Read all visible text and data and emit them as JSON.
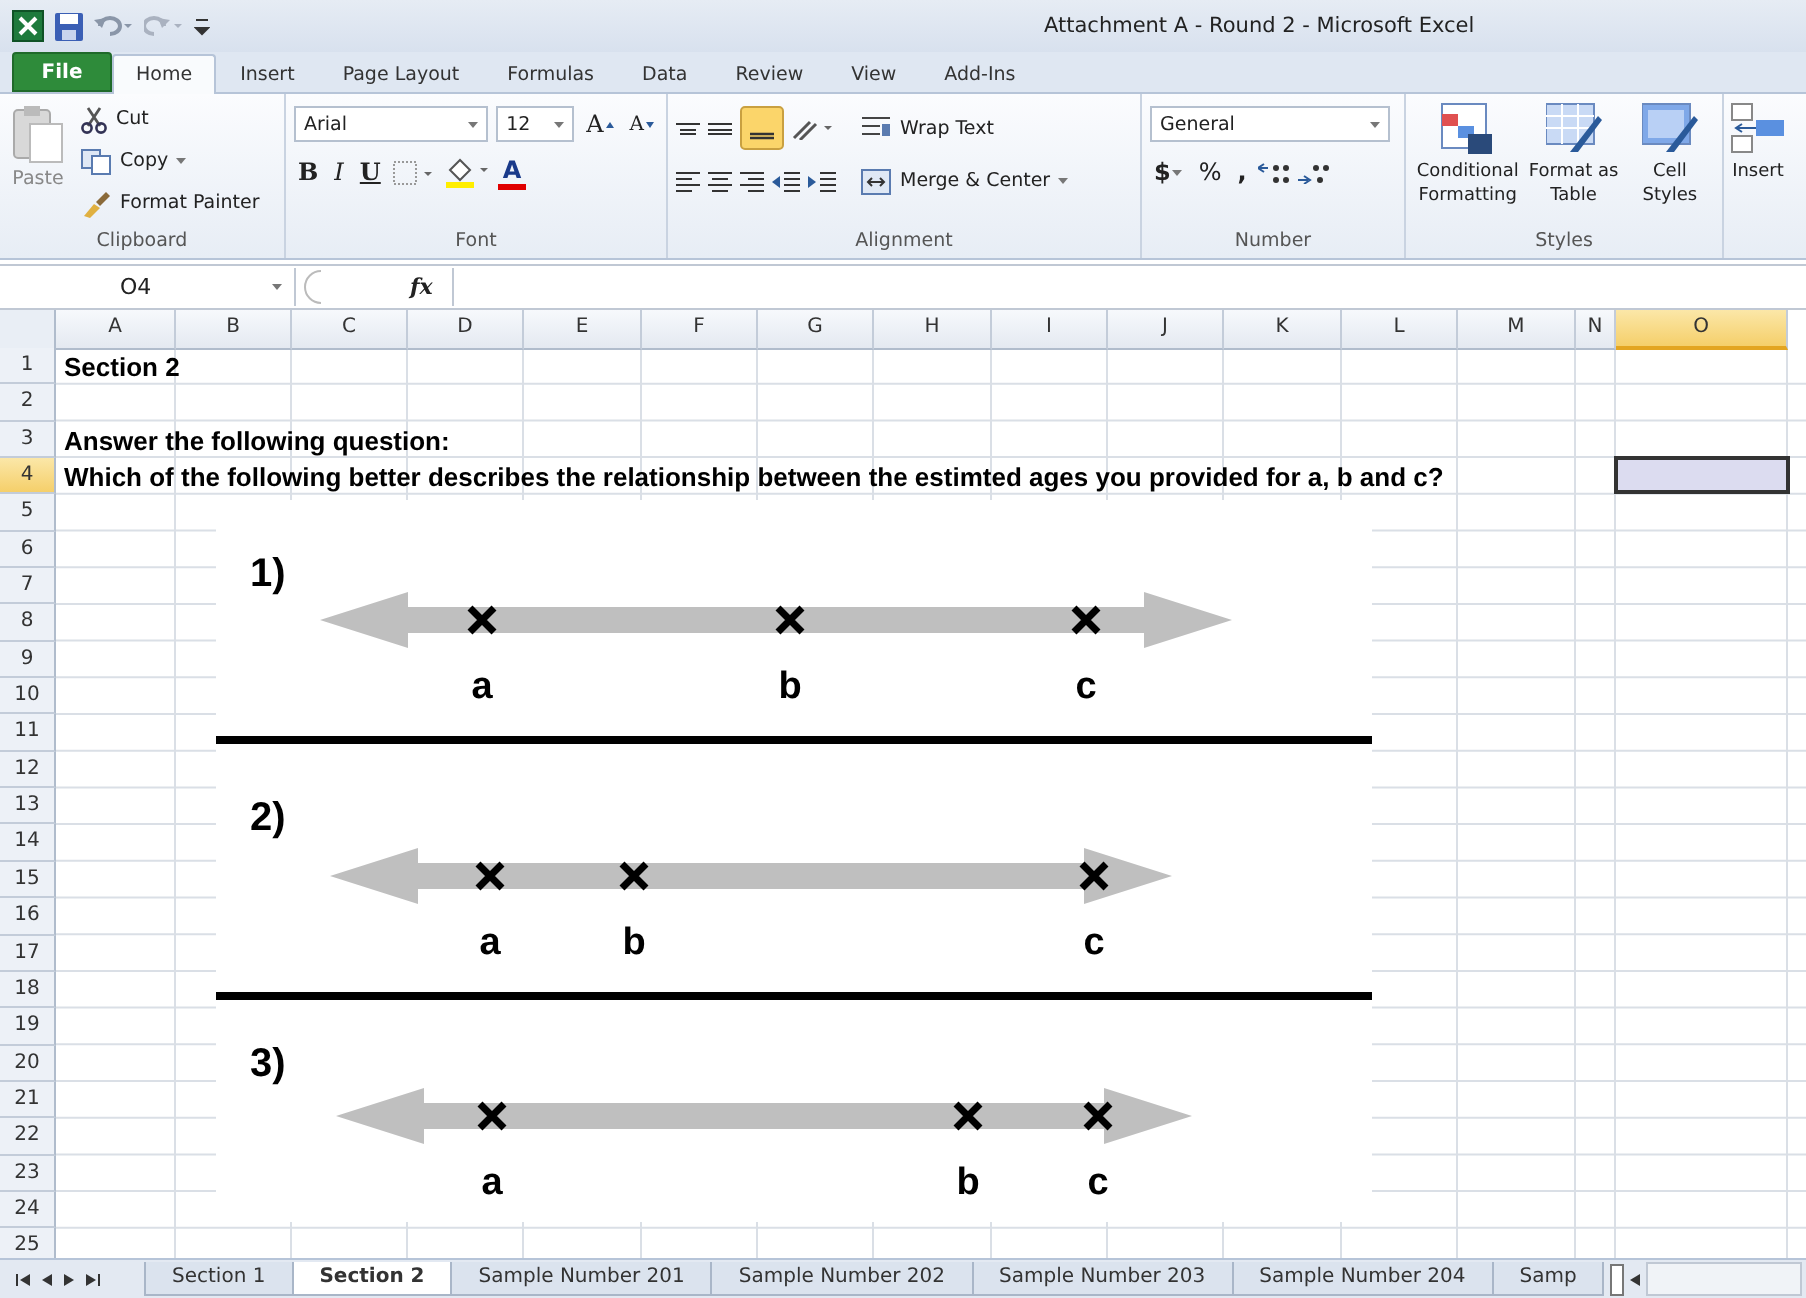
{
  "window": {
    "title": "Attachment A - Round 2 - Microsoft Excel"
  },
  "ribbon_tabs": [
    {
      "label": "File",
      "selected": false,
      "kind": "file"
    },
    {
      "label": "Home",
      "selected": true,
      "kind": "tab"
    },
    {
      "label": "Insert",
      "selected": false,
      "kind": "tab"
    },
    {
      "label": "Page Layout",
      "selected": false,
      "kind": "tab"
    },
    {
      "label": "Formulas",
      "selected": false,
      "kind": "tab"
    },
    {
      "label": "Data",
      "selected": false,
      "kind": "tab"
    },
    {
      "label": "Review",
      "selected": false,
      "kind": "tab"
    },
    {
      "label": "View",
      "selected": false,
      "kind": "tab"
    },
    {
      "label": "Add-Ins",
      "selected": false,
      "kind": "tab"
    }
  ],
  "clipboard": {
    "paste": "Paste",
    "cut": "Cut",
    "copy": "Copy",
    "format_painter": "Format Painter",
    "label": "Clipboard"
  },
  "font": {
    "name": "Arial",
    "size": "12",
    "grow": "A",
    "shrink": "A",
    "bold": "B",
    "italic": "I",
    "underline": "U",
    "color_letter": "A",
    "label": "Font"
  },
  "alignment": {
    "wrap": "Wrap Text",
    "merge": "Merge & Center",
    "bottom_align_on": true,
    "label": "Alignment"
  },
  "number": {
    "format": "General",
    "currency": "$",
    "percent": "%",
    "comma": ",",
    "label": "Number"
  },
  "styles": {
    "buttons": [
      "Conditional Formatting",
      "Format as Table",
      "Cell Styles"
    ],
    "label": "Styles"
  },
  "cells": {
    "insert": "Insert"
  },
  "formula_bar": {
    "name_box": "O4",
    "function_label": "fx"
  },
  "columns": [
    {
      "label": "A",
      "selected": false
    },
    {
      "label": "B",
      "selected": false
    },
    {
      "label": "C",
      "selected": false
    },
    {
      "label": "D",
      "selected": false
    },
    {
      "label": "E",
      "selected": false
    },
    {
      "label": "F",
      "selected": false
    },
    {
      "label": "G",
      "selected": false
    },
    {
      "label": "H",
      "selected": false
    },
    {
      "label": "I",
      "selected": false
    },
    {
      "label": "J",
      "selected": false
    },
    {
      "label": "K",
      "selected": false
    },
    {
      "label": "L",
      "selected": false
    },
    {
      "label": "M",
      "selected": false
    },
    {
      "label": "N",
      "selected": false
    },
    {
      "label": "O",
      "selected": true
    }
  ],
  "rows": [
    {
      "number": "1",
      "selected": false,
      "text": "Section 2"
    },
    {
      "number": "2",
      "selected": false
    },
    {
      "number": "3",
      "selected": false,
      "text": "Answer the following question:"
    },
    {
      "number": "4",
      "selected": true,
      "text": "Which of the following better describes the relationship between the estimted ages you provided for a, b and c?"
    },
    {
      "number": "5",
      "selected": false
    },
    {
      "number": "6",
      "selected": false
    },
    {
      "number": "7",
      "selected": false
    },
    {
      "number": "8",
      "selected": false
    },
    {
      "number": "9",
      "selected": false
    },
    {
      "number": "10",
      "selected": false
    },
    {
      "number": "11",
      "selected": false
    },
    {
      "number": "12",
      "selected": false
    },
    {
      "number": "13",
      "selected": false
    },
    {
      "number": "14",
      "selected": false
    },
    {
      "number": "15",
      "selected": false
    },
    {
      "number": "16",
      "selected": false
    },
    {
      "number": "17",
      "selected": false
    },
    {
      "number": "18",
      "selected": false
    },
    {
      "number": "19",
      "selected": false
    },
    {
      "number": "20",
      "selected": false
    },
    {
      "number": "21",
      "selected": false
    },
    {
      "number": "22",
      "selected": false
    },
    {
      "number": "23",
      "selected": false
    },
    {
      "number": "24",
      "selected": false
    },
    {
      "number": "25",
      "selected": false
    }
  ],
  "diagram": {
    "options": [
      {
        "number": "1)",
        "marks": [
          "a",
          "b",
          "c"
        ]
      },
      {
        "number": "2)",
        "marks": [
          "a",
          "b",
          "c"
        ]
      },
      {
        "number": "3)",
        "marks": [
          "a",
          "b",
          "c"
        ]
      }
    ]
  },
  "sheet_tabs": [
    {
      "label": "Section 1",
      "selected": false
    },
    {
      "label": "Section 2",
      "selected": true
    },
    {
      "label": "Sample Number 201",
      "selected": false
    },
    {
      "label": "Sample Number 202",
      "selected": false
    },
    {
      "label": "Sample Number 203",
      "selected": false
    },
    {
      "label": "Sample Number 204",
      "selected": false
    },
    {
      "label": "Samp",
      "selected": false
    }
  ]
}
